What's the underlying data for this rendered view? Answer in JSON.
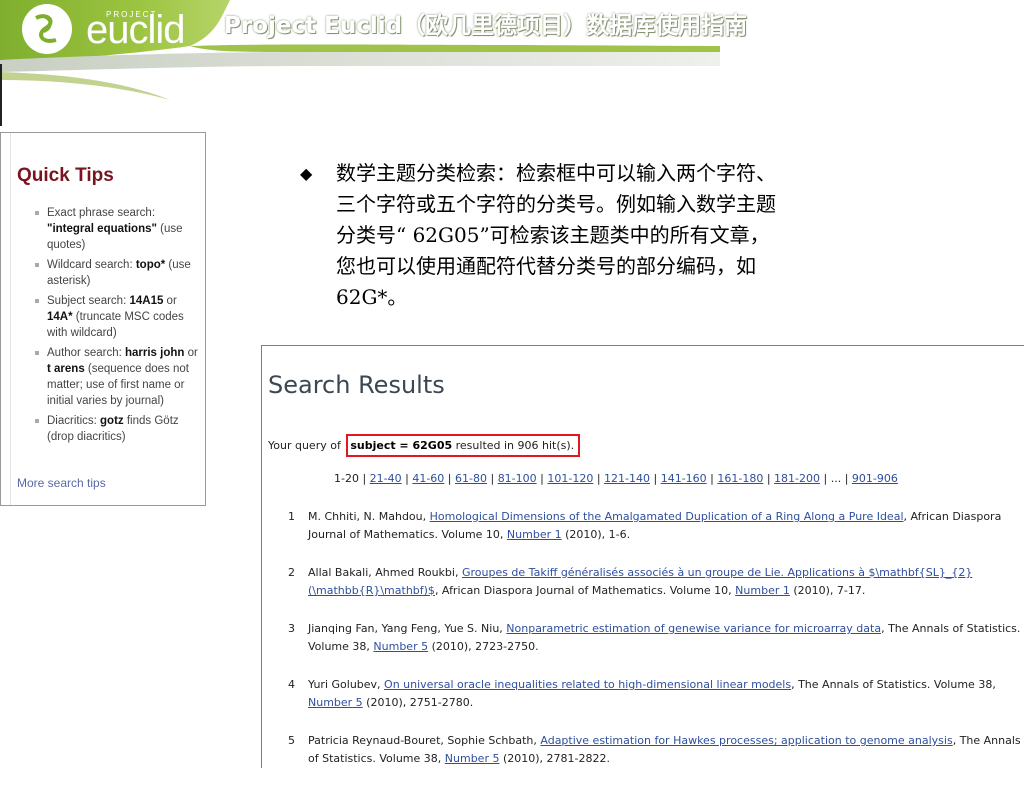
{
  "header": {
    "logo_small": "PROJECT",
    "logo_word": "euclid",
    "title": "Project Euclid（欧几里德项目）数据库使用指南"
  },
  "quick_tips": {
    "title": "Quick Tips",
    "items": [
      {
        "pre": "Exact phrase search: ",
        "bold": "\"integral equations\"",
        "post": " (use quotes)"
      },
      {
        "pre": "Wildcard search: ",
        "bold": "topo*",
        "post": " (use asterisk)"
      },
      {
        "pre": "Subject search: ",
        "bold": "14A15",
        "mid": " or ",
        "bold2": "14A*",
        "post": " (truncate MSC codes with wildcard)"
      },
      {
        "pre": "Author search: ",
        "bold": "harris john",
        "mid": " or ",
        "bold2": "t arens",
        "post": " (sequence does not matter; use of first name or initial varies by journal)"
      },
      {
        "pre": "Diacritics: ",
        "bold": "gotz",
        "post": " finds Götz (drop diacritics)"
      }
    ],
    "more_link": "More search tips"
  },
  "bullet_text": "数学主题分类检索：检索框中可以输入两个字符、\n三个字符或五个字符的分类号。例如输入数学主题\n分类号“ 62G05”可检索该主题类中的所有文章，\n您也可以使用通配符代替分类号的部分编码，如\n62G*。",
  "results": {
    "heading": "Search Results",
    "query_prefix": "Your query of ",
    "query_term": "subject = 62G05",
    "query_suffix": " resulted in 906 hit(s).",
    "pager_current": "1-20",
    "pager_links": [
      "21-40",
      "41-60",
      "61-80",
      "81-100",
      "101-120",
      "121-140",
      "141-160",
      "161-180",
      "181-200"
    ],
    "pager_ellipsis": "...",
    "pager_last": "901-906",
    "items": [
      {
        "num": "1",
        "authors": "M. Chhiti, N. Mahdou, ",
        "title": "Homological Dimensions of the Amalgamated Duplication of a Ring Along a Pure Ideal",
        "journal": ", African Diaspora Journal of Mathematics. Volume 10, ",
        "issue": "Number 1",
        "pages": " (2010), 1-6."
      },
      {
        "num": "2",
        "authors": "Allal Bakali, Ahmed Roukbi, ",
        "title": "Groupes de Takiff généralisés associés à un groupe de Lie. Applications à $\\mathbf{SL}_{2}(\\mathbb{R}\\mathbf)$",
        "journal": ", African Diaspora Journal of Mathematics. Volume 10, ",
        "issue": "Number 1",
        "pages": " (2010), 7-17."
      },
      {
        "num": "3",
        "authors": "Jianqing Fan, Yang Feng, Yue S. Niu, ",
        "title": "Nonparametric estimation of genewise variance for microarray data",
        "journal": ", The Annals of Statistics. Volume 38, ",
        "issue": "Number 5",
        "pages": " (2010), 2723-2750."
      },
      {
        "num": "4",
        "authors": "Yuri Golubev, ",
        "title": "On universal oracle inequalities related to high-dimensional linear models",
        "journal": ", The Annals of Statistics. Volume 38, ",
        "issue": "Number 5",
        "pages": " (2010), 2751-2780."
      },
      {
        "num": "5",
        "authors": "Patricia Reynaud-Bouret, Sophie Schbath, ",
        "title": "Adaptive estimation for Hawkes processes; application to genome analysis",
        "journal": ", The Annals of Statistics. Volume 38, ",
        "issue": "Number 5",
        "pages": " (2010), 2781-2822."
      }
    ]
  }
}
